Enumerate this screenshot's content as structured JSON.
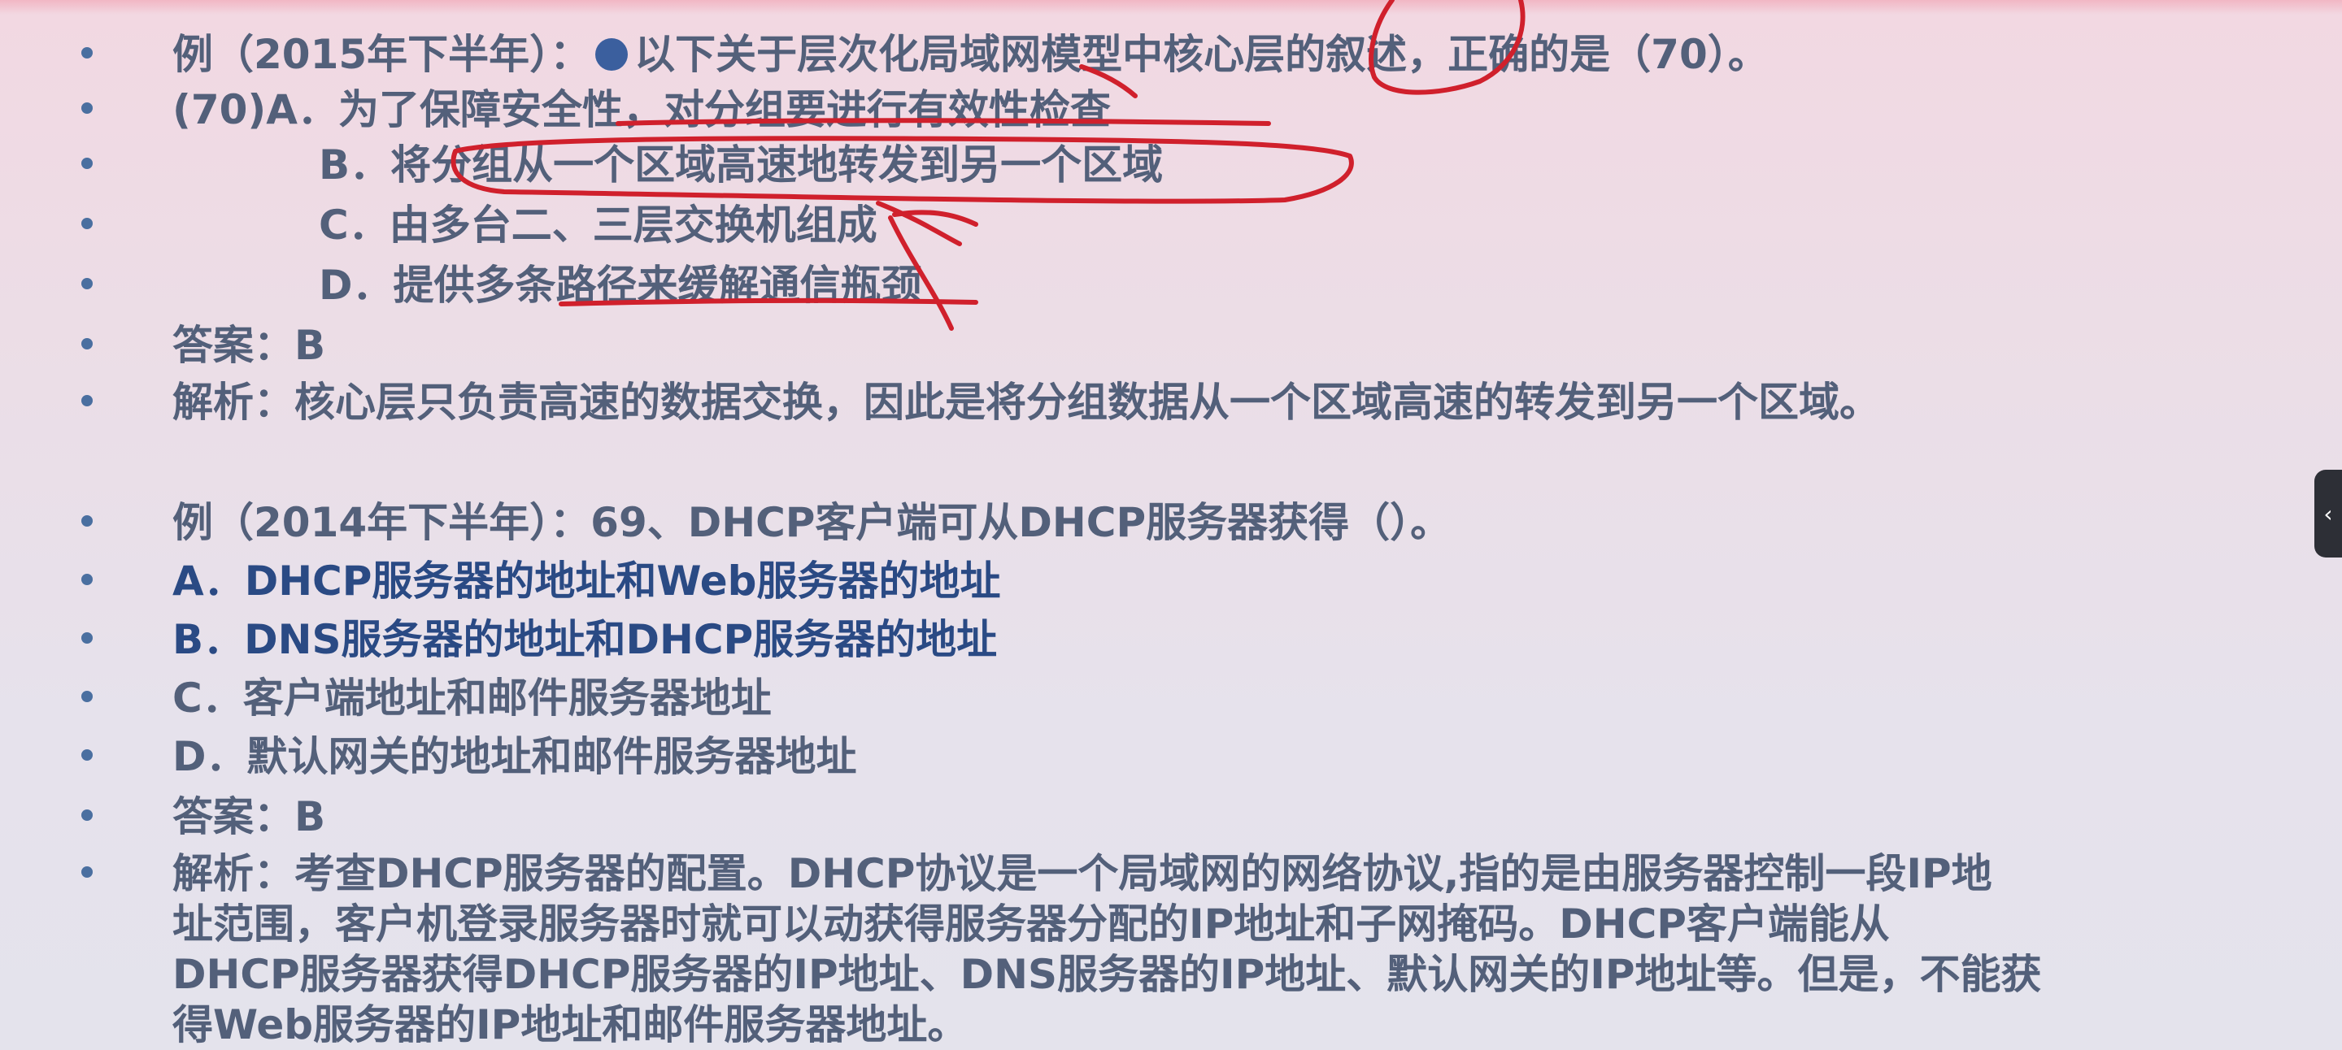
{
  "ex1": {
    "title_pre": "例（2015年下半年）：",
    "title_post": "以下关于层次化局域网模型中核心层的叙述，正确的是（70）。",
    "opt_a": "(70)A．为了保障安全性，对分组要进行有效性检查",
    "opt_b": "B．将分组从一个区域高速地转发到另一个区域",
    "opt_c": "C．由多台二、三层交换机组成",
    "opt_d": "D．提供多条路径来缓解通信瓶颈",
    "answer": "答案：B",
    "analysis": "解析：核心层只负责高速的数据交换，因此是将分组数据从一个区域高速的转发到另一个区域。"
  },
  "ex2": {
    "title": "例（2014年下半年）：69、DHCP客户端可从DHCP服务器获得（）。",
    "opt_a": "A．DHCP服务器的地址和Web服务器的地址",
    "opt_b": "B．DNS服务器的地址和DHCP服务器的地址",
    "opt_c": "C．客户端地址和邮件服务器地址",
    "opt_d": "D．默认网关的地址和邮件服务器地址",
    "answer": "答案：B",
    "analysis_lines": [
      "解析：考查DHCP服务器的配置。DHCP协议是一个局域网的网络协议,指的是由服务器控制一段IP地",
      "址范围，客户机登录服务器时就可以动获得服务器分配的IP地址和子网掩码。DHCP客户端能从",
      "DHCP服务器获得DHCP服务器的IP地址、DNS服务器的IP地址、默认网关的IP地址等。但是，不能获",
      "得Web服务器的IP地址和邮件服务器地址。"
    ]
  },
  "side_tab_glyph": "‹",
  "colors": {
    "body_text": "#53607a",
    "option_text": "#2a4a84",
    "bullet": "#4a6fa0",
    "annotation_ink": "#d0202c"
  }
}
